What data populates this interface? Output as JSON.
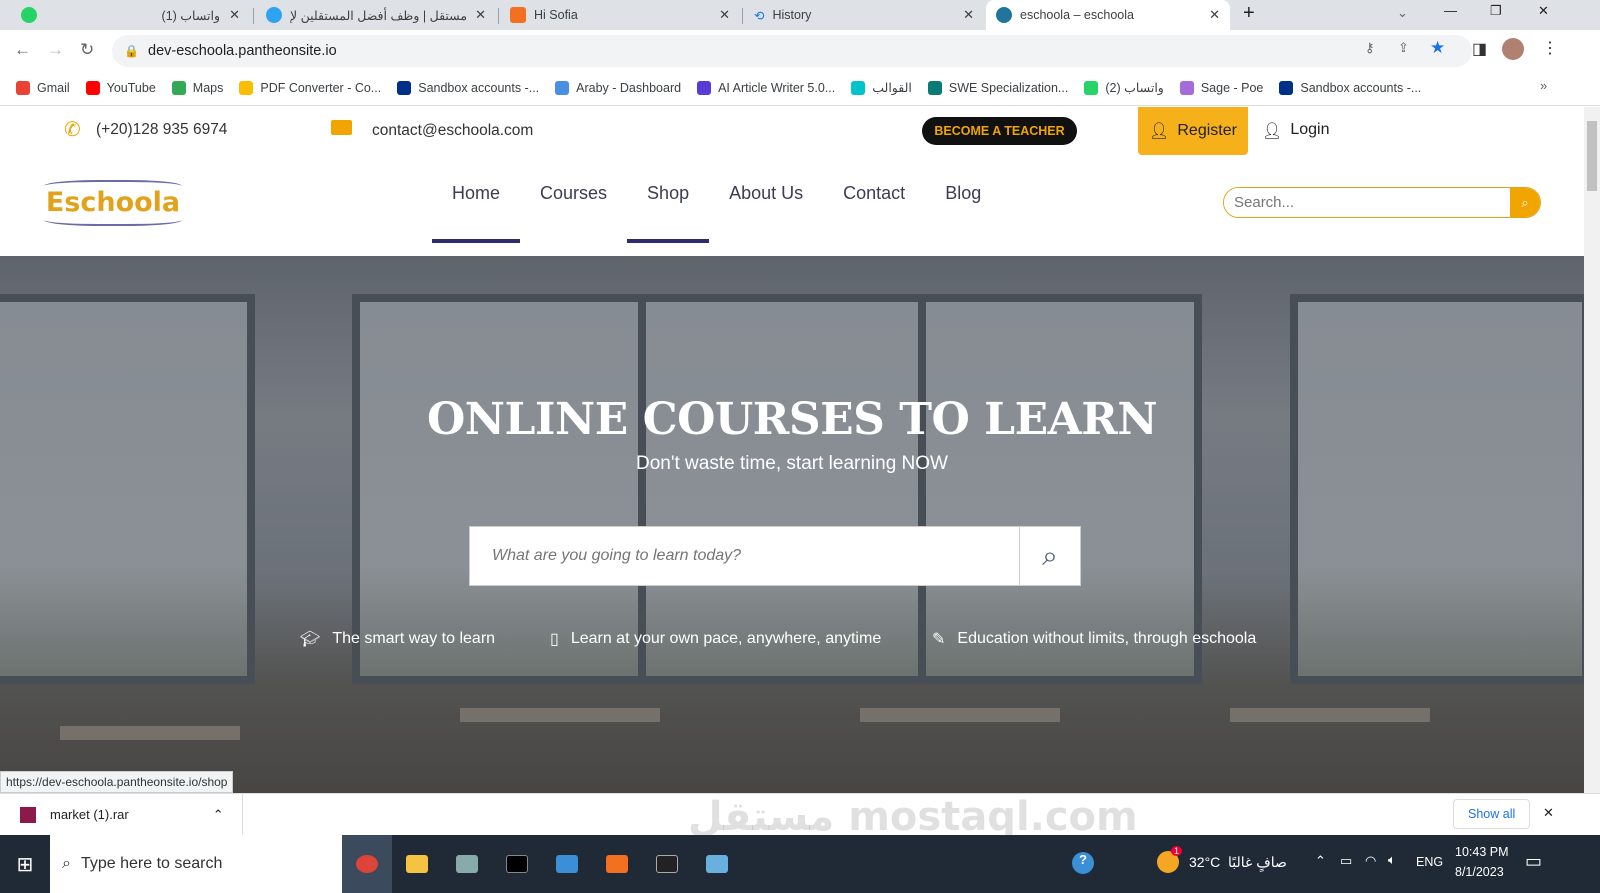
{
  "browser": {
    "tabs": [
      {
        "title": "(1) واتساب",
        "icon": "whatsapp-icon",
        "color": "#25d366"
      },
      {
        "title": "مستقل | وظف أفضل المستقلين لإ",
        "icon": "mostaql-icon",
        "color": "#2ea3f2"
      },
      {
        "title": "Hi Sofia",
        "icon": "xampp-icon",
        "color": "#f37021"
      },
      {
        "title": "History",
        "icon": "history-icon",
        "color": "#1a73e8"
      },
      {
        "title": "eschoola – eschoola",
        "icon": "wordpress-icon",
        "color": "#21759b",
        "active": true
      }
    ],
    "url": "dev-eschoola.pantheonsite.io",
    "bookmarks": [
      {
        "label": "Gmail",
        "color": "#ea4335"
      },
      {
        "label": "YouTube",
        "color": "#ff0000"
      },
      {
        "label": "Maps",
        "color": "#34a853"
      },
      {
        "label": "PDF Converter - Co...",
        "color": "#fbbc04"
      },
      {
        "label": "Sandbox accounts -...",
        "color": "#003087"
      },
      {
        "label": "Araby - Dashboard",
        "color": "#4a90e2"
      },
      {
        "label": "AI Article Writer 5.0...",
        "color": "#5b3bd6"
      },
      {
        "label": "القوالب",
        "color": "#00c4cc"
      },
      {
        "label": "SWE Specialization...",
        "color": "#0b7a75"
      },
      {
        "label": "(2) واتساب",
        "color": "#25d366"
      },
      {
        "label": "Sage - Poe",
        "color": "#a56bd8"
      },
      {
        "label": "Sandbox accounts -...",
        "color": "#003087"
      }
    ],
    "status_url": "https://dev-eschoola.pantheonsite.io/shop"
  },
  "site": {
    "phone": "(+20)128 935 6974",
    "email": "contact@eschoola.com",
    "become_teacher": "BECOME A TEACHER",
    "register": "Register",
    "login": "Login",
    "logo": "Eschoola",
    "menu": [
      "Home",
      "Courses",
      "Shop",
      "About Us",
      "Contact",
      "Blog"
    ],
    "search_placeholder": "Search...",
    "hero_title": "ONLINE COURSES TO LEARN",
    "hero_sub": "Don't waste time, start learning NOW",
    "hero_search_placeholder": "What are you going to learn today?",
    "features": [
      "The smart way to learn",
      "Learn at your own pace, anywhere, anytime",
      "Education without limits, through eschoola"
    ],
    "accent": "#f0a500"
  },
  "downloads": {
    "file": "market (1).rar",
    "show_all": "Show all"
  },
  "watermark": "مستقل mostaql.com",
  "taskbar": {
    "search_placeholder": "Type here to search",
    "temp": "32°C",
    "weather": "صافٍ غالبًا",
    "lang": "ENG",
    "time": "10:43 PM",
    "date": "8/1/2023",
    "weather_badge": "1"
  }
}
